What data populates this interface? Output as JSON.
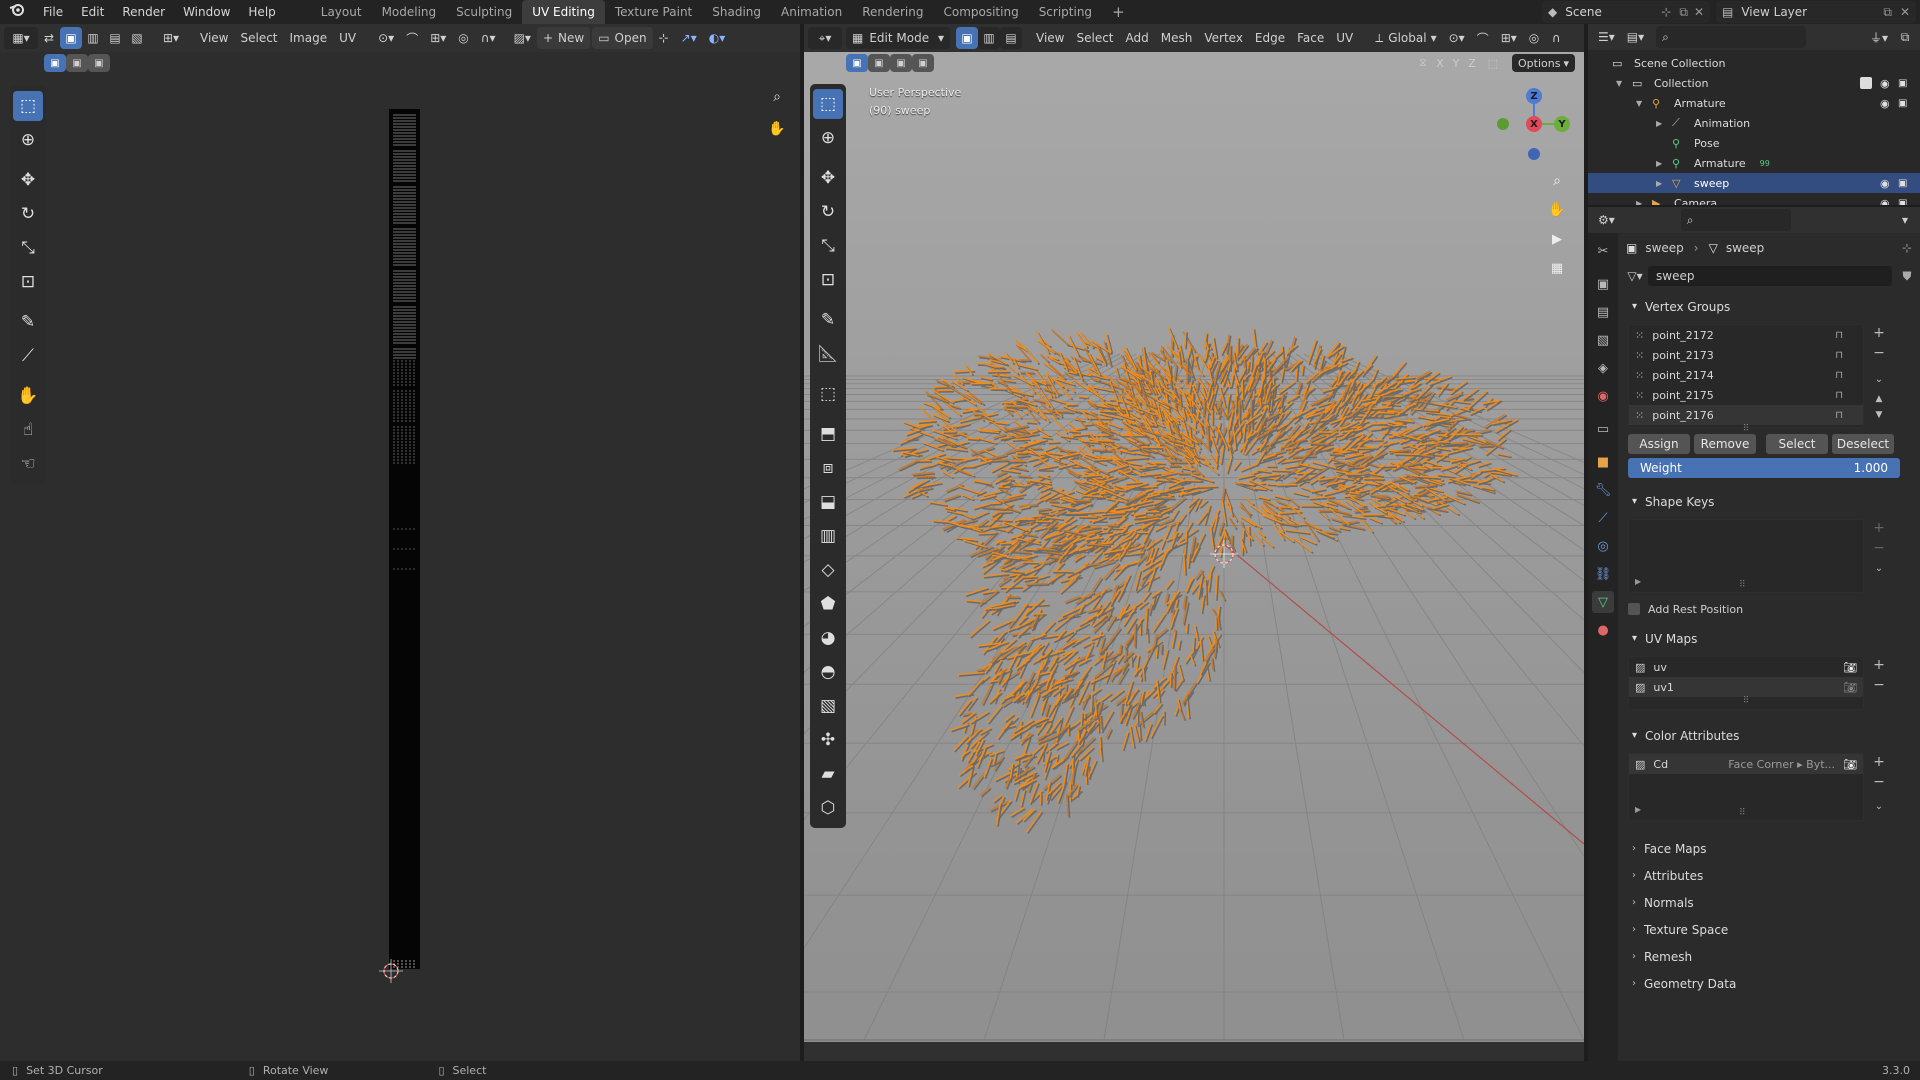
{
  "topbar": {
    "menus": [
      "File",
      "Edit",
      "Render",
      "Window",
      "Help"
    ],
    "workspaces": [
      "Layout",
      "Modeling",
      "Sculpting",
      "UV Editing",
      "Texture Paint",
      "Shading",
      "Animation",
      "Rendering",
      "Compositing",
      "Scripting"
    ],
    "active_workspace": "UV Editing",
    "add_tab": "+",
    "scene": "Scene",
    "view_layer": "View Layer"
  },
  "uv_editor": {
    "menus": [
      "View",
      "Select",
      "Image",
      "UV"
    ],
    "new_label": "New",
    "open_label": "Open"
  },
  "viewport": {
    "mode": "Edit Mode",
    "menus": [
      "View",
      "Select",
      "Add",
      "Mesh",
      "Vertex",
      "Edge",
      "Face",
      "UV"
    ],
    "transform_orientation": "Global",
    "axes_xyz": [
      "X",
      "Y",
      "Z"
    ],
    "options_label": "Options",
    "overlay_title": "User Perspective",
    "overlay_object": "(90) sweep",
    "gizmo": {
      "x": "X",
      "y": "Y",
      "z": "Z"
    }
  },
  "outliner": {
    "rows": [
      {
        "label": "Scene Collection",
        "indent": 0,
        "icon": "scene-collection-icon"
      },
      {
        "label": "Collection",
        "indent": 1,
        "icon": "collection-icon"
      },
      {
        "label": "Armature",
        "indent": 2,
        "icon": "armature-icon"
      },
      {
        "label": "Animation",
        "indent": 3,
        "icon": "animation-icon"
      },
      {
        "label": "Pose",
        "indent": 3,
        "icon": "pose-icon"
      },
      {
        "label": "Armature",
        "indent": 3,
        "icon": "armature-data-icon",
        "badge": "99"
      },
      {
        "label": "sweep",
        "indent": 3,
        "icon": "mesh-icon",
        "selected": true
      },
      {
        "label": "Camera",
        "indent": 2,
        "icon": "camera-icon"
      }
    ]
  },
  "properties": {
    "breadcrumb": [
      "sweep",
      "sweep"
    ],
    "data_name": "sweep",
    "vertex_groups": {
      "title": "Vertex Groups",
      "items": [
        "point_2172",
        "point_2173",
        "point_2174",
        "point_2175",
        "point_2176"
      ],
      "assign": "Assign",
      "remove": "Remove",
      "select": "Select",
      "deselect": "Deselect",
      "weight_label": "Weight",
      "weight_value": "1.000"
    },
    "shape_keys": {
      "title": "Shape Keys"
    },
    "add_rest_position": "Add Rest Position",
    "uv_maps": {
      "title": "UV Maps",
      "items": [
        "uv",
        "uv1"
      ]
    },
    "color_attributes": {
      "title": "Color Attributes",
      "items": [
        {
          "name": "Cd",
          "domain": "Face Corner ▸ Byt..."
        }
      ]
    },
    "collapsed_sections": [
      "Face Maps",
      "Attributes",
      "Normals",
      "Texture Space",
      "Remesh",
      "Geometry Data"
    ]
  },
  "statusbar": {
    "hint1": "Set 3D Cursor",
    "hint2": "Rotate View",
    "hint3": "Select",
    "version": "3.3.0"
  }
}
